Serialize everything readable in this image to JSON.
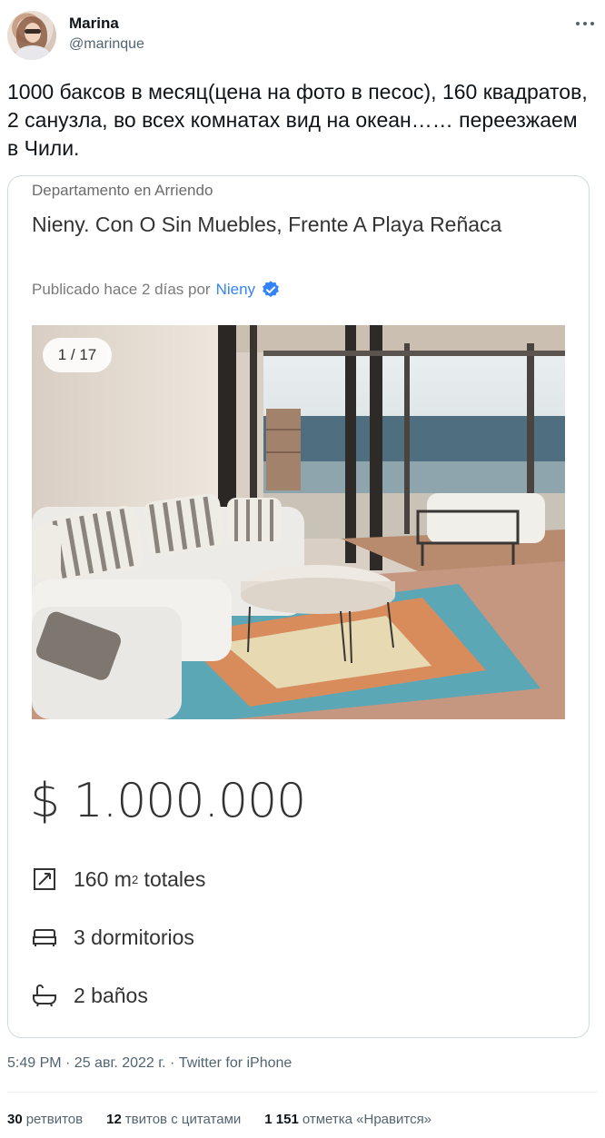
{
  "author": {
    "name": "Marina",
    "handle": "@marinque"
  },
  "tweet": {
    "text": "1000 баксов в месяц(цена на фото в песос), 160 квадратов, 2 санузла, во всех комнатах вид на океан…… переезжаем в Чили."
  },
  "listing": {
    "type": "Departamento en Arriendo",
    "title": "Nieny. Con O Sin Muebles, Frente A Playa Reñaca",
    "published_prefix": "Publicado hace 2 días por",
    "seller": "Nieny",
    "photo_counter": "1 / 17",
    "price": "$ 1.000.000",
    "area_value": "160 m",
    "area_sup": "2",
    "area_suffix": " totales",
    "bedrooms": "3 dormitorios",
    "bathrooms": "2 baños",
    "accent_color": "#3483fa"
  },
  "meta": {
    "timestamp": "5:49 PM · 25 авг. 2022 г. · Twitter for iPhone"
  },
  "stats": [
    {
      "count": "30",
      "label": "ретвитов"
    },
    {
      "count": "12",
      "label": "твитов с цитатами"
    },
    {
      "count": "1 151",
      "label": "отметка «Нравится»"
    }
  ]
}
